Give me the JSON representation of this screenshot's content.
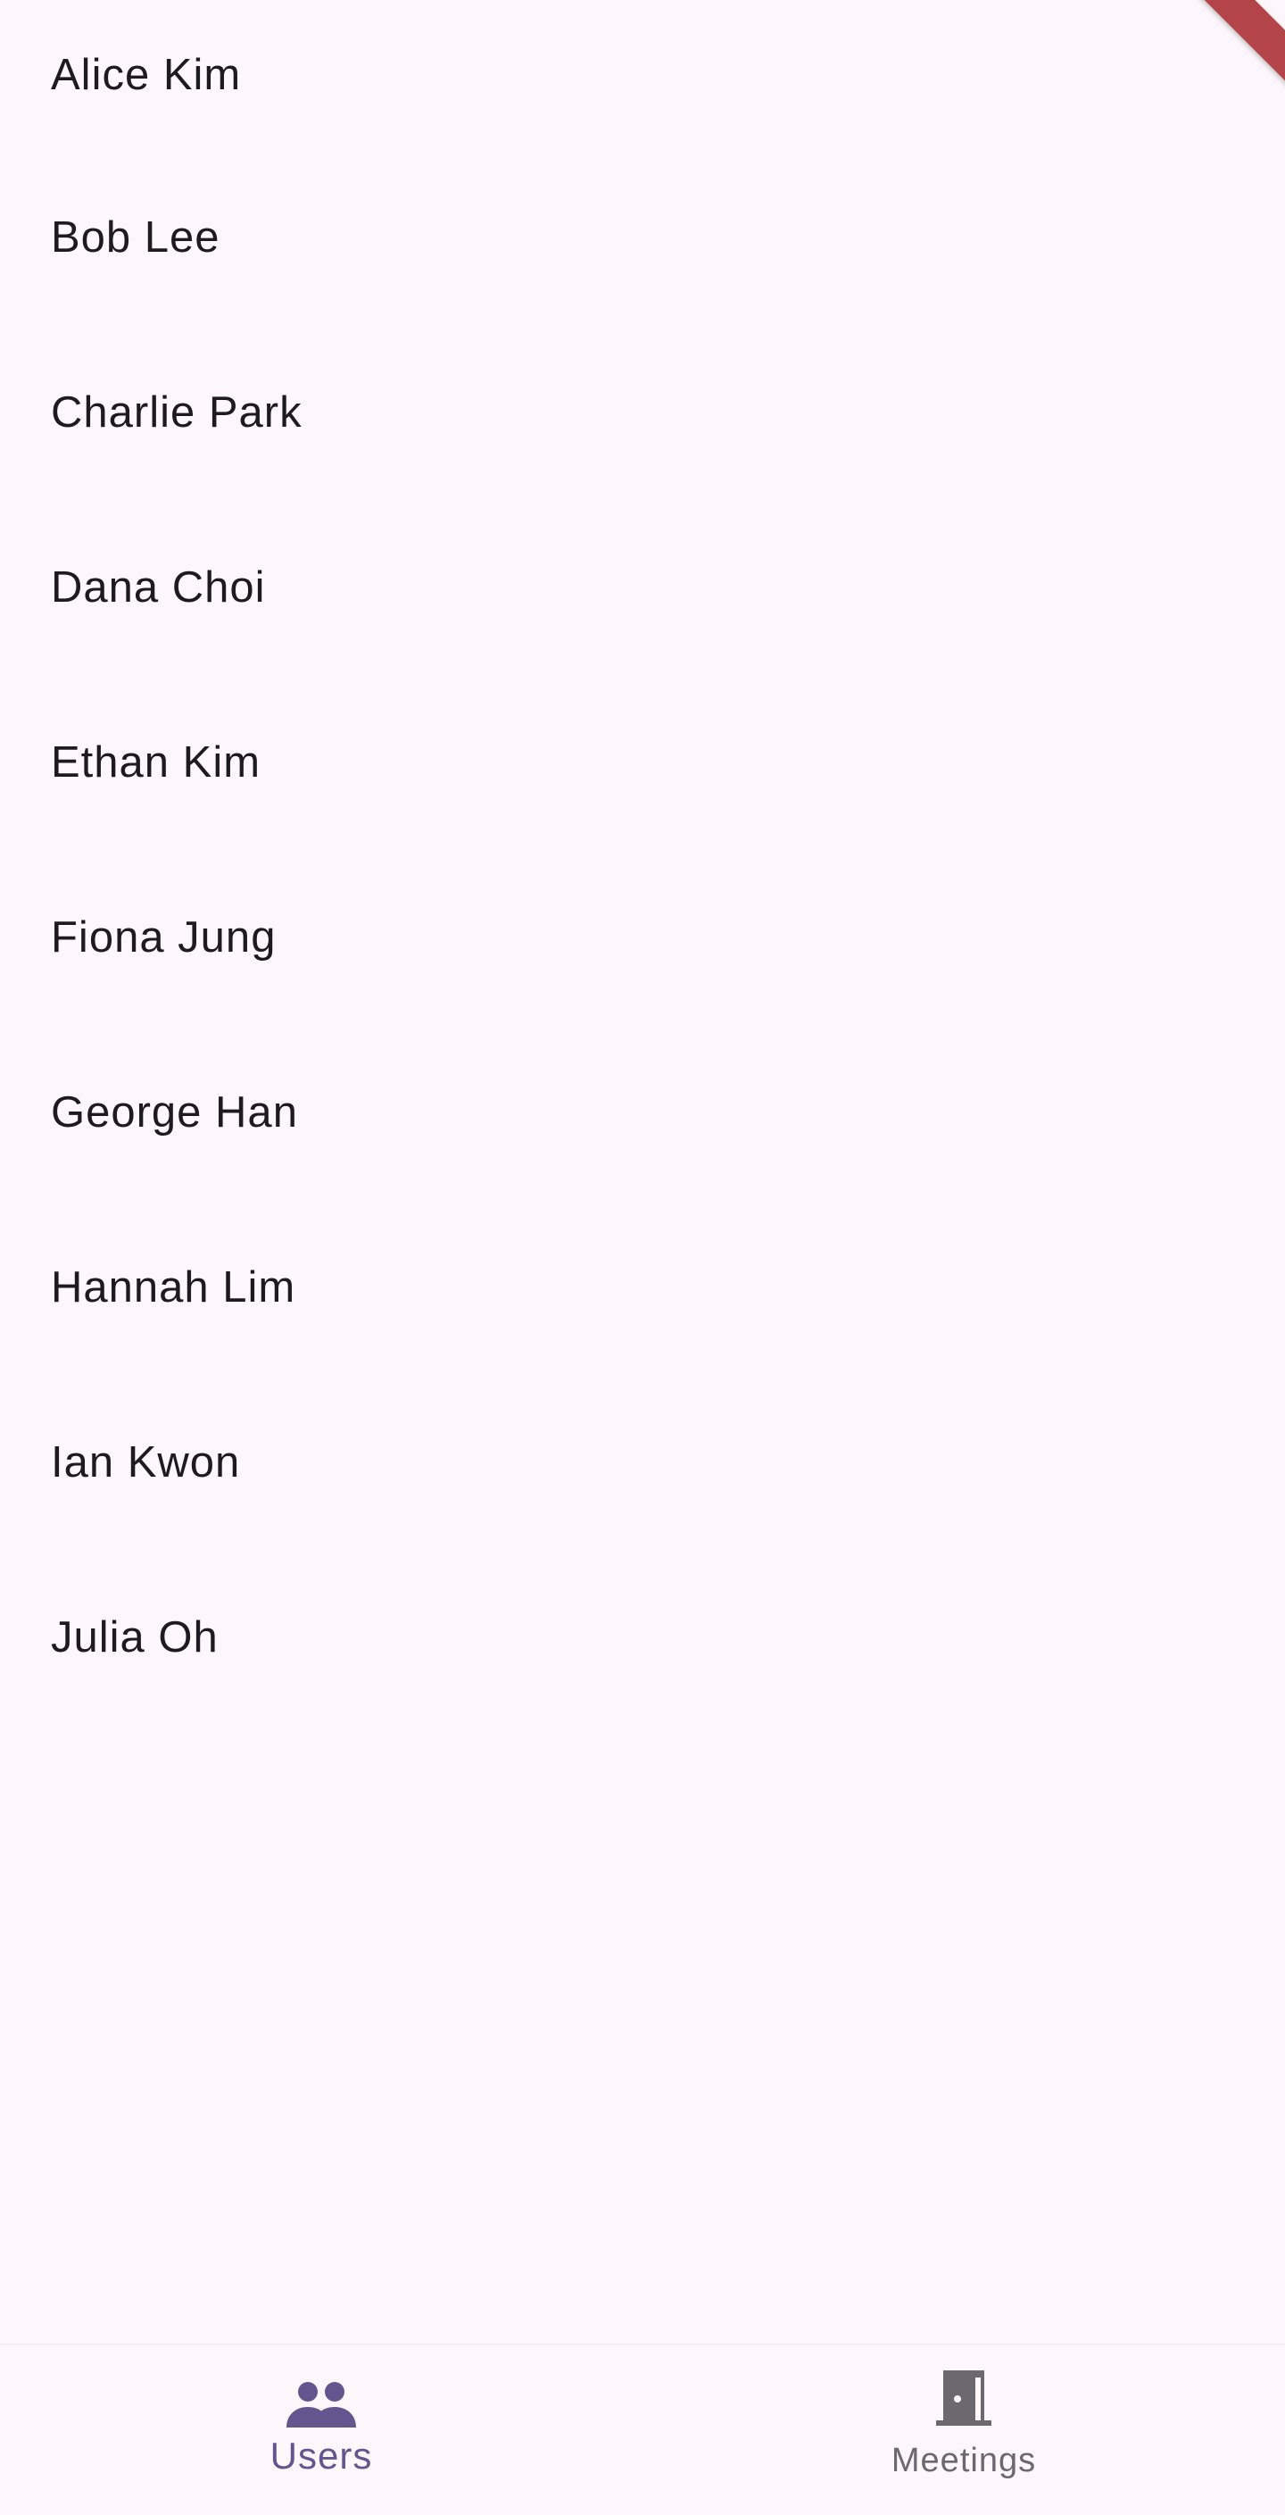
{
  "users": {
    "items": [
      {
        "name": "Alice Kim"
      },
      {
        "name": "Bob Lee"
      },
      {
        "name": "Charlie Park"
      },
      {
        "name": "Dana Choi"
      },
      {
        "name": "Ethan Kim"
      },
      {
        "name": "Fiona Jung"
      },
      {
        "name": "George Han"
      },
      {
        "name": "Hannah Lim"
      },
      {
        "name": "Ian Kwon"
      },
      {
        "name": "Julia Oh"
      }
    ]
  },
  "bottom_nav": {
    "selected": "Users",
    "items": [
      {
        "label": "Users",
        "icon": "people-icon",
        "active": true
      },
      {
        "label": "Meetings",
        "icon": "door-icon",
        "active": false
      }
    ]
  },
  "colors": {
    "background": "#fdf7fc",
    "text": "#1d1b20",
    "accent": "#65558f",
    "inactive": "#6b6870",
    "debug_banner": "#b3454a"
  }
}
